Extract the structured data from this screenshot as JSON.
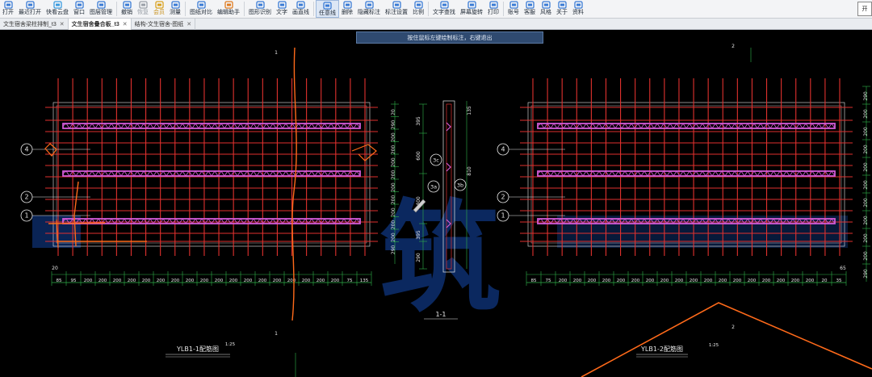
{
  "toolbar": {
    "items": [
      {
        "label": "打开",
        "icon": "folder-open-icon",
        "color": "#3a7bd5"
      },
      {
        "label": "最近打开",
        "icon": "recent-icon",
        "color": "#3a7bd5"
      },
      {
        "label": "快看云盘",
        "icon": "cloud-icon",
        "color": "#3a9be0"
      },
      {
        "label": "窗口",
        "icon": "window-icon",
        "color": "#3a7bd5"
      },
      {
        "label": "图层管理",
        "icon": "layers-icon",
        "color": "#3a7bd5"
      },
      {
        "label": "撤销",
        "icon": "undo-icon",
        "color": "#3a7bd5"
      },
      {
        "label": "恢复",
        "icon": "redo-icon",
        "color": "#9aa0a8",
        "dim": true
      },
      {
        "label": "会员",
        "icon": "vip-icon",
        "color": "#d9a21f",
        "gold": true
      },
      {
        "label": "测量",
        "icon": "measure-icon",
        "color": "#3a7bd5"
      },
      {
        "label": "图纸对比",
        "icon": "compare-icon",
        "color": "#3a7bd5"
      },
      {
        "label": "编辑助手",
        "icon": "edit-assistant-icon",
        "color": "#e07b1f"
      },
      {
        "label": "图形识别",
        "icon": "shape-recognition-icon",
        "color": "#3a7bd5"
      },
      {
        "label": "文字",
        "icon": "text-icon",
        "color": "#3a7bd5"
      },
      {
        "label": "画直线",
        "icon": "line-icon",
        "color": "#3a7bd5"
      },
      {
        "label": "任意线",
        "icon": "freehand-line-icon",
        "color": "#3a7bd5",
        "active": true
      },
      {
        "label": "删除",
        "icon": "delete-icon",
        "color": "#3a7bd5"
      },
      {
        "label": "隐藏标注",
        "icon": "hide-annotation-icon",
        "color": "#3a7bd5"
      },
      {
        "label": "标注设置",
        "icon": "annotation-settings-icon",
        "color": "#3a7bd5"
      },
      {
        "label": "比例",
        "icon": "scale-icon",
        "color": "#3a7bd5"
      },
      {
        "label": "文字查找",
        "icon": "text-search-icon",
        "color": "#3a7bd5"
      },
      {
        "label": "屏幕旋转",
        "icon": "rotate-screen-icon",
        "color": "#3a7bd5"
      },
      {
        "label": "打印",
        "icon": "print-icon",
        "color": "#3a7bd5"
      },
      {
        "label": "账号",
        "icon": "account-icon",
        "color": "#3a7bd5"
      },
      {
        "label": "客服",
        "icon": "support-icon",
        "color": "#3a7bd5"
      },
      {
        "label": "风格",
        "icon": "style-icon",
        "color": "#3a7bd5"
      },
      {
        "label": "关于",
        "icon": "about-icon",
        "color": "#3a7bd5"
      },
      {
        "label": "资料",
        "icon": "materials-icon",
        "color": "#3a7bd5"
      }
    ],
    "right_button": "开"
  },
  "tabs": [
    {
      "label": "文生宿舍梁柱排制_t3",
      "active": false,
      "close": "✕"
    },
    {
      "label": "文生宿舍叠合板_t3",
      "active": true,
      "close": "✕"
    },
    {
      "label": "结构-文生宿舍-图纸",
      "active": false,
      "close": "✕"
    }
  ],
  "hint": "按住鼠标左键绘制标注，右键退出",
  "drawing": {
    "colors": {
      "rebar": "#e0312e",
      "mesh": "#d25ad6",
      "dim": "#2fb24a",
      "white": "#e8e8e8",
      "markup": "#ff6a1a",
      "watermark": "#0d2d6a"
    },
    "left_panel": {
      "spacings": [
        "85",
        "95",
        "200",
        "200",
        "200",
        "200",
        "200",
        "200",
        "200",
        "200",
        "200",
        "200",
        "200",
        "200",
        "200",
        "200",
        "200",
        "200",
        "200",
        "200",
        "75",
        "135"
      ],
      "top_offset": "20",
      "axes": [
        "4",
        "2",
        "1"
      ],
      "section_mark": "1",
      "title": "YLB1-1配筋图",
      "scale": "1:25"
    },
    "right_panel": {
      "spacings": [
        "85",
        "75",
        "200",
        "200",
        "200",
        "200",
        "200",
        "200",
        "200",
        "200",
        "200",
        "200",
        "200",
        "200",
        "200",
        "200",
        "200",
        "200",
        "200",
        "200",
        "20",
        "35"
      ],
      "top_offset": "65",
      "axes": [
        "4",
        "2",
        "1"
      ],
      "section_mark": "2",
      "title": "YLB1-2配筋图",
      "scale": "1:25",
      "right_dims": [
        "290",
        "200",
        "200",
        "200",
        "200",
        "200",
        "200",
        "200",
        "200",
        "200",
        "290"
      ]
    },
    "left_vertical_dims": [
      "20",
      "290",
      "200",
      "200",
      "200",
      "200",
      "200",
      "200",
      "200",
      "200",
      "200",
      "290"
    ],
    "section": {
      "title": "1-1",
      "dims": [
        "395",
        "600",
        "400",
        "395",
        "290"
      ],
      "total": "810",
      "top": "135",
      "bubbles": [
        "3c",
        "3a",
        "3b"
      ]
    },
    "watermark": "筑"
  }
}
